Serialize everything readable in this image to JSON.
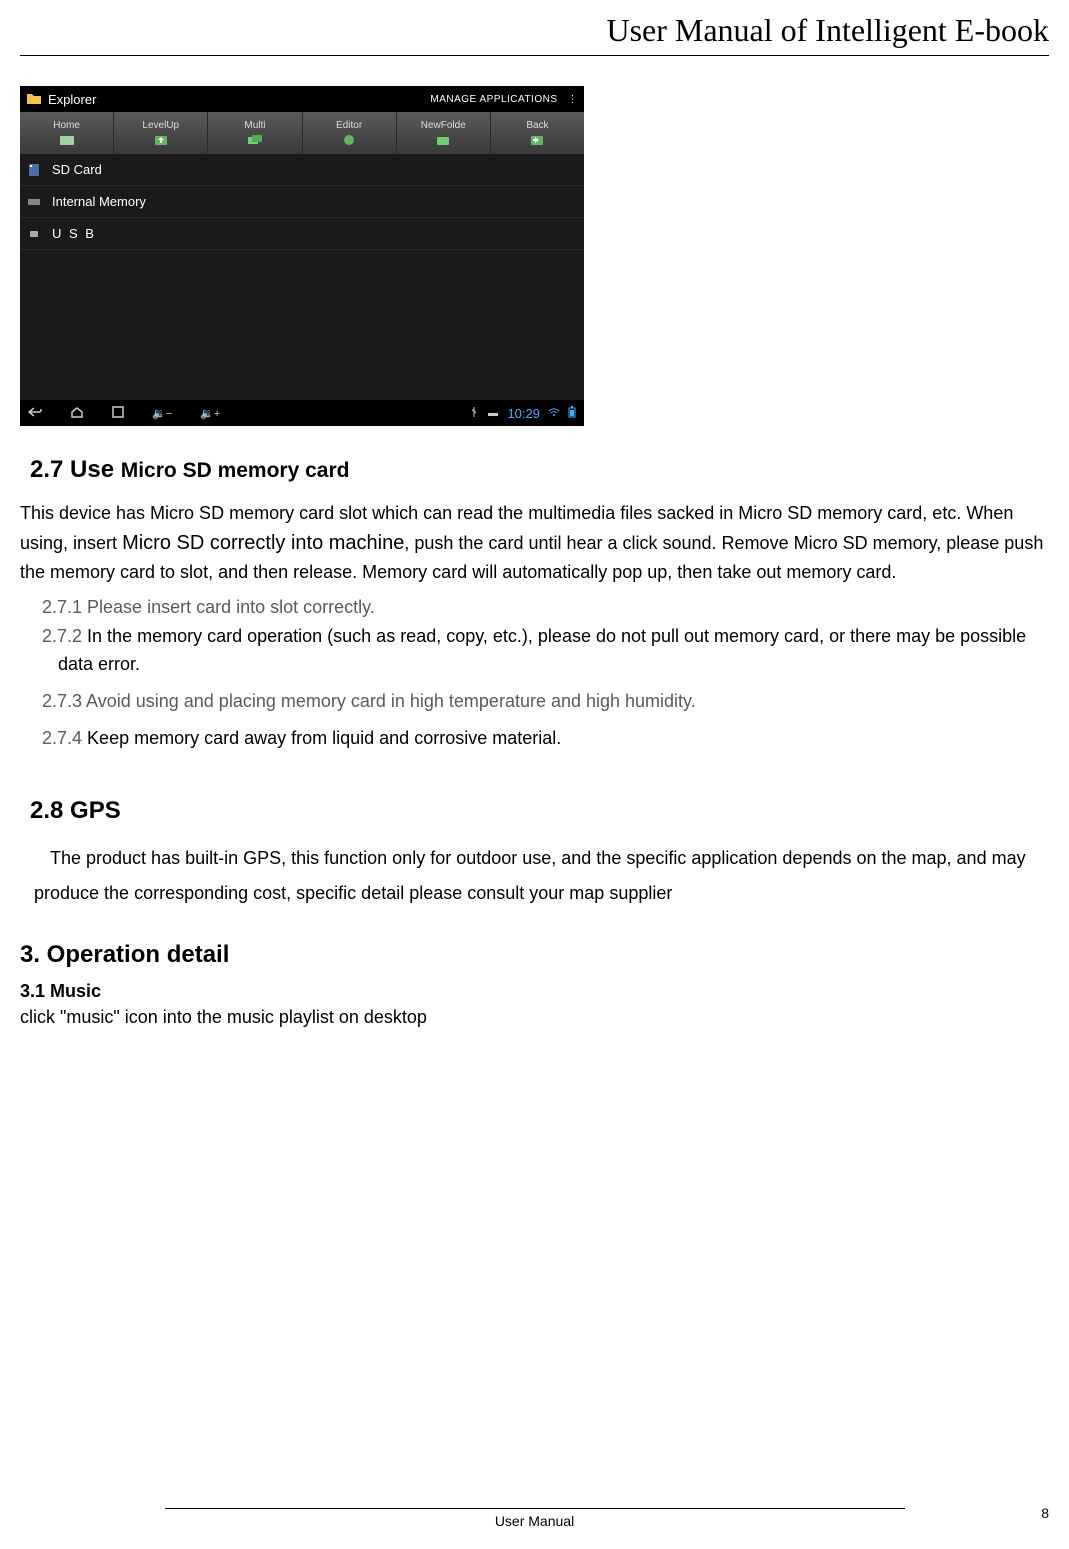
{
  "header": {
    "title": "User Manual of Intelligent E-book"
  },
  "screenshot": {
    "title": "Explorer",
    "manage": "MANAGE APPLICATIONS",
    "tools": [
      {
        "label": "Home"
      },
      {
        "label": "LevelUp"
      },
      {
        "label": "Multi"
      },
      {
        "label": "Editor"
      },
      {
        "label": "NewFolde"
      },
      {
        "label": "Back"
      }
    ],
    "rows": [
      {
        "label": "SD Card"
      },
      {
        "label": "Internal Memory"
      },
      {
        "label": "U S B"
      }
    ],
    "clock": "10:29"
  },
  "sections": {
    "s27": {
      "heading_bold": "2.7 Use",
      "heading_rest": "Micro SD memory card",
      "body_pre": "This device has Micro SD memory card slot which can read the multimedia files sacked in Micro SD memory card, etc. When using, insert ",
      "body_emph": "Micro SD correctly into machine",
      "body_post": ", push the card until hear a click sound. Remove Micro SD memory, please push the memory card to slot, and then release. Memory card will automatically pop up, then take out memory card.",
      "items": {
        "i1": "2.7.1 Please insert card into slot correctly.",
        "i2_num": "2.7.2 ",
        "i2_text": "In the memory card operation (such as read, copy, etc.), please do not pull out memory card, or there may be possible data error.",
        "i3": "2.7.3 Avoid using and placing memory card in high temperature and high humidity.",
        "i4_num": "2.7.4 ",
        "i4_text": "Keep memory card away from liquid and corrosive material."
      }
    },
    "s28": {
      "heading": "2.8 GPS",
      "body": "The product has built-in GPS, this function only for outdoor use, and the specific application depends on the map, and may produce the corresponding cost, specific detail please consult your map supplier"
    },
    "s3": {
      "heading": "3. Operation detail",
      "sub": "3.1 Music",
      "body": "click \"music\" icon into the music playlist on desktop"
    }
  },
  "footer": {
    "center": "User Manual",
    "page": "8"
  }
}
